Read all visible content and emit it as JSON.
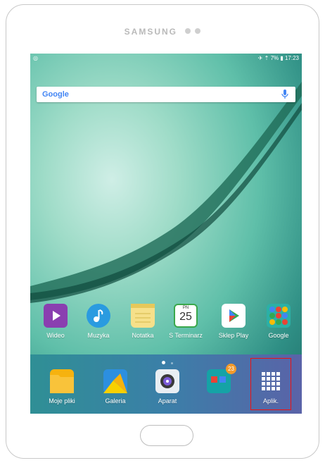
{
  "device": {
    "brand": "SAMSUNG"
  },
  "status": {
    "left": "◎",
    "right": "✈ ⇡ 7% ▮ 17:23"
  },
  "search": {
    "logo": "Google"
  },
  "home_apps": [
    {
      "label": "Wideo"
    },
    {
      "label": "Muzyka"
    },
    {
      "label": "Notatka"
    },
    {
      "label": "S Terminarz",
      "day": "PN",
      "date": "25"
    },
    {
      "label": "Sklep Play"
    },
    {
      "label": "Google"
    }
  ],
  "dock_apps": [
    {
      "label": "Moje pliki"
    },
    {
      "label": "Galeria"
    },
    {
      "label": "Aparat"
    },
    {
      "label": "",
      "badge": "23"
    },
    {
      "label": "Aplik."
    }
  ],
  "colors": {
    "accent": "#e11111",
    "search_mic": "#4285f4"
  }
}
